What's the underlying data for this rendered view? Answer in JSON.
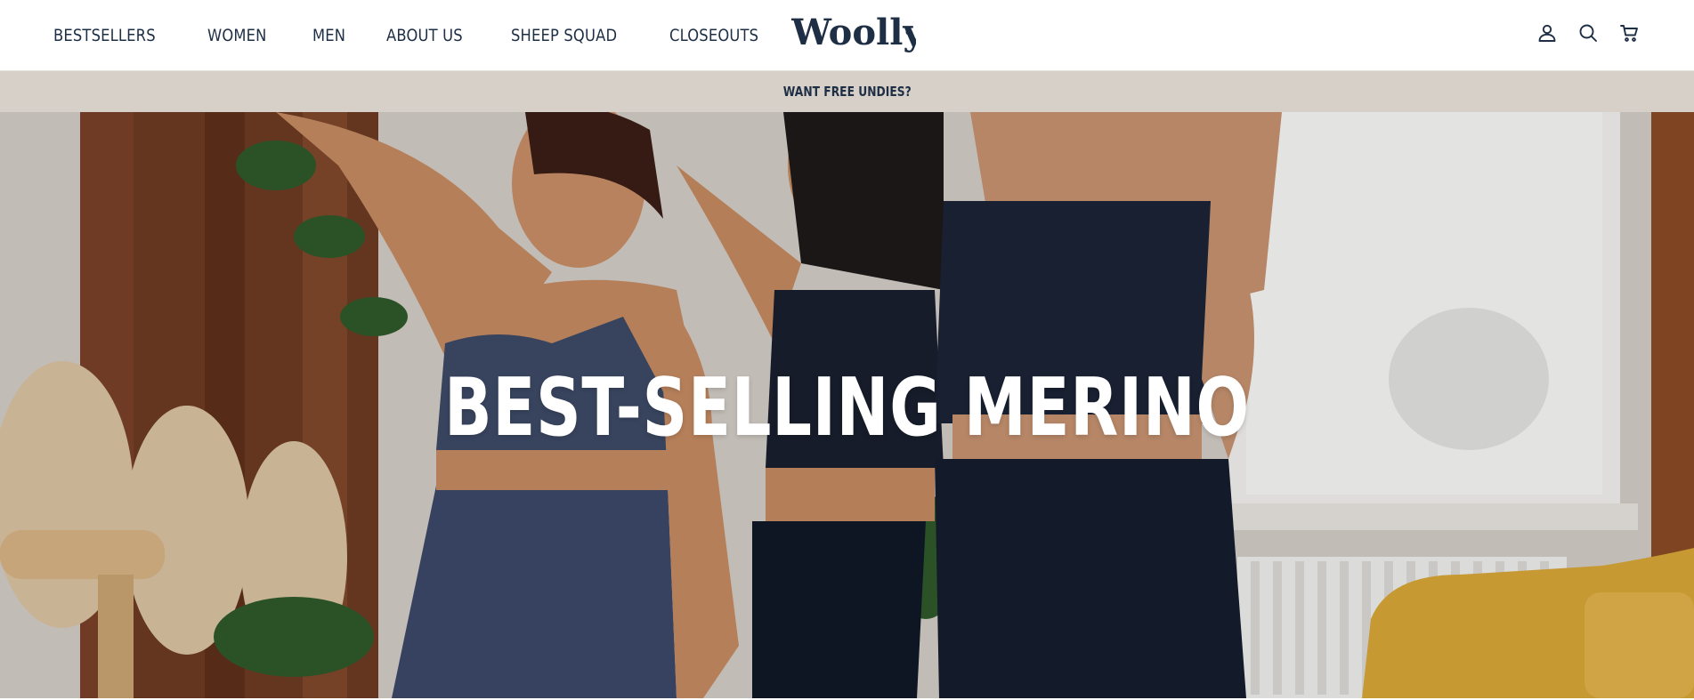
{
  "header": {
    "nav": [
      {
        "label": "BESTSELLERS"
      },
      {
        "label": "WOMEN"
      },
      {
        "label": "MEN"
      },
      {
        "label": "ABOUT US"
      },
      {
        "label": "SHEEP SQUAD"
      },
      {
        "label": "CLOSEOUTS"
      }
    ],
    "logo_text": "Woolly",
    "icons": [
      "account-icon",
      "search-icon",
      "cart-icon"
    ]
  },
  "announcement": {
    "text": "WANT FREE UNDIES?"
  },
  "hero": {
    "title": "BEST-SELLING MERINO"
  },
  "colors": {
    "navy": "#1e2f45",
    "announcement_bg": "#d6d0c8",
    "white": "#ffffff"
  }
}
